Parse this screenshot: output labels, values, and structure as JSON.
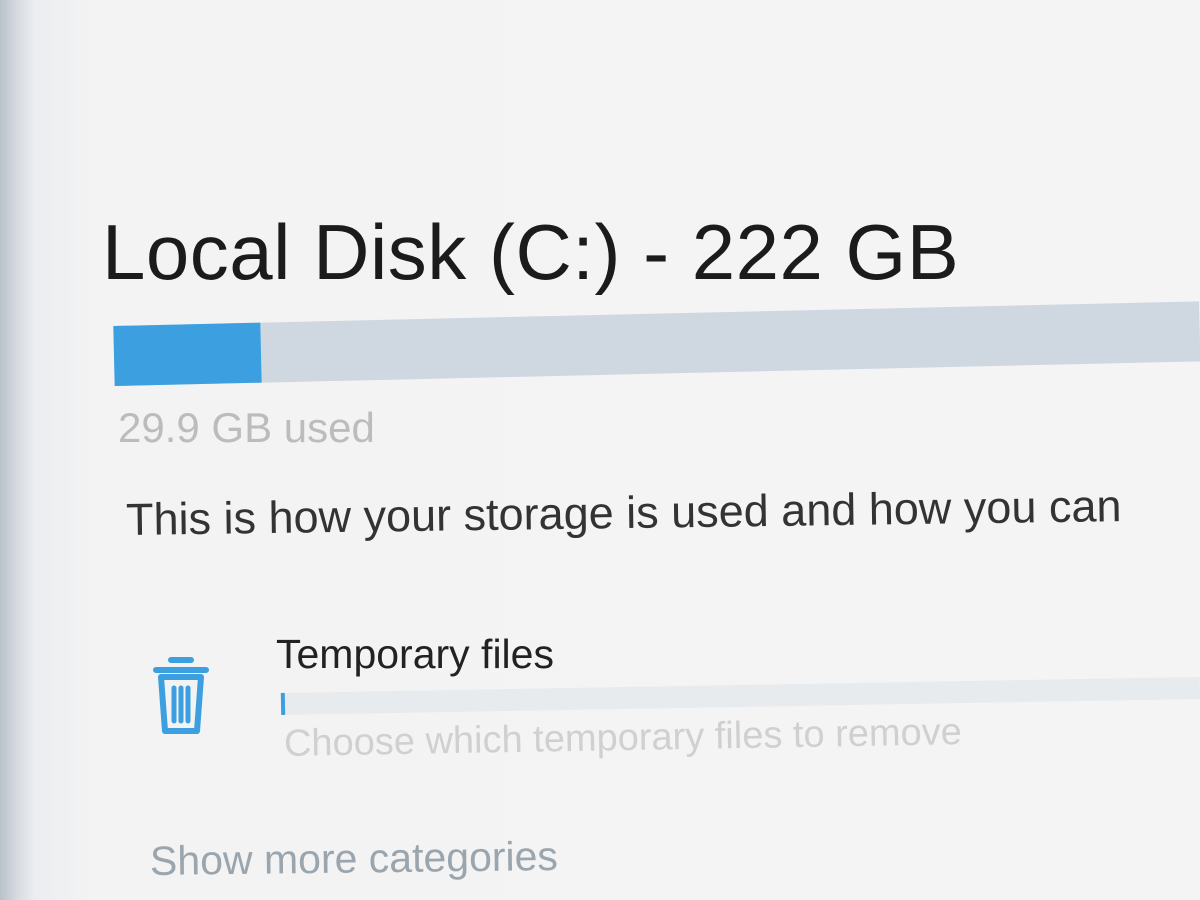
{
  "storage": {
    "title": "Local Disk (C:) - 222 GB",
    "used_label": "29.9 GB used",
    "used_fraction": 0.135,
    "description": "This is how your storage is used and how you can",
    "accent_color": "#3c9fdf",
    "track_color": "#cfd7e1"
  },
  "categories": [
    {
      "icon": "trash-icon",
      "name": "Temporary files",
      "subtitle": "Choose which temporary files to remove",
      "used_fraction": 0.004
    }
  ],
  "actions": {
    "show_more": "Show more categories"
  }
}
